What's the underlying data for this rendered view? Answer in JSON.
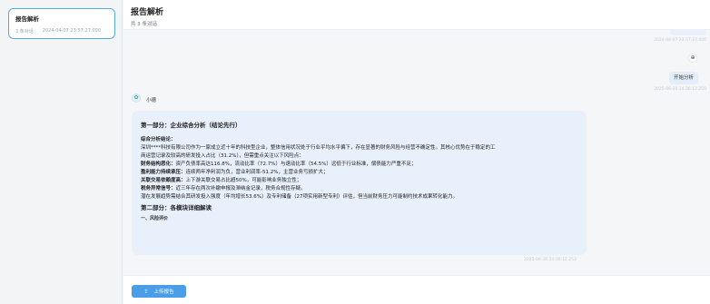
{
  "sidebar": {
    "conversation": {
      "title": "报告解析",
      "count": "3 条对话",
      "timestamp": "2024-04-07 23:57:27.000"
    }
  },
  "header": {
    "title": "报告解析",
    "subtitle": "共 3 条对话"
  },
  "chat": {
    "ts_top": "2024-04-07 23:57:27.000",
    "user_icon": "⊕",
    "user_message": "开始分析",
    "ts_user": "2025-06-20 14:36:12.250",
    "bot_icon": "✿",
    "bot_name": "小德",
    "ts_bot": "2025-06-20 14:36:12.253",
    "report": {
      "section1_title": "第一部分：企业综合分析（结论先行）",
      "conclusion_label": "综合分析结论：",
      "intro_1": "深圳****科技有限公司作为一家成立近十年的科技型企业，整体信用状况处于行业平均水平偏下，存在显著的财务风险与经营不确定性。其核心优势在于稳定的工",
      "intro_2": "商运营记录及较高的研发投入占比（31.2%），但需重点关注以下风险点：",
      "items": [
        {
          "label": "财务结构恶化：",
          "text": "资产负债率高达116.8%，流动比率（72.7%）与速动比率（54.5%）远低于行业标准，偿债能力严重不足；"
        },
        {
          "label": "盈利能力持续承压：",
          "text": "连续两年净利润为负，营业利润率-51.2%，主营业务亏损扩大；"
        },
        {
          "label": "关联交易依赖度高：",
          "text": "上下游关联交易占比超50%，可能影响业务独立性；"
        },
        {
          "label": "税务异常信号：",
          "text": "近三年存在两次补缴申报及滞纳金记录，税务合规性存疑。"
        }
      ],
      "closing": "潜在发展趋势需结合其研发投入强度（年均增长53.6%）及专利储备（27项实用新型专利）评估，但当前财务压力可能制约技术成果转化能力。",
      "section2_title": "第二部分：各模块详细解读",
      "sub_item": "一、风险评价"
    }
  },
  "footer": {
    "upload_icon": "⇪",
    "upload_label": "上传报告"
  }
}
